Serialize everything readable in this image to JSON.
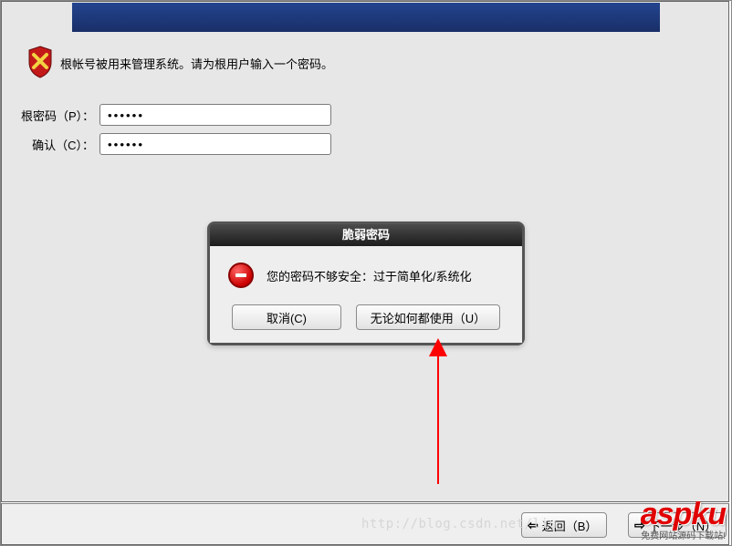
{
  "instruction": "根帐号被用来管理系统。请为根用户输入一个密码。",
  "form": {
    "password_label": "根密码（P）：",
    "password_value": "••••••",
    "confirm_label": "确认（C）：",
    "confirm_value": "••••••"
  },
  "dialog": {
    "title": "脆弱密码",
    "message": "您的密码不够安全：过于简单化/系统化",
    "cancel": "取消(C)",
    "use_anyway": "无论如何都使用（U）"
  },
  "nav": {
    "back": "返回（B）",
    "next": "下一步（N）",
    "back_arrow": "⇦",
    "next_arrow": "⇨"
  },
  "watermark": {
    "url": "http://blog.csdn.net/liu",
    "logo_big": "aspku",
    "logo_small": "免费网站源码下载站!"
  }
}
